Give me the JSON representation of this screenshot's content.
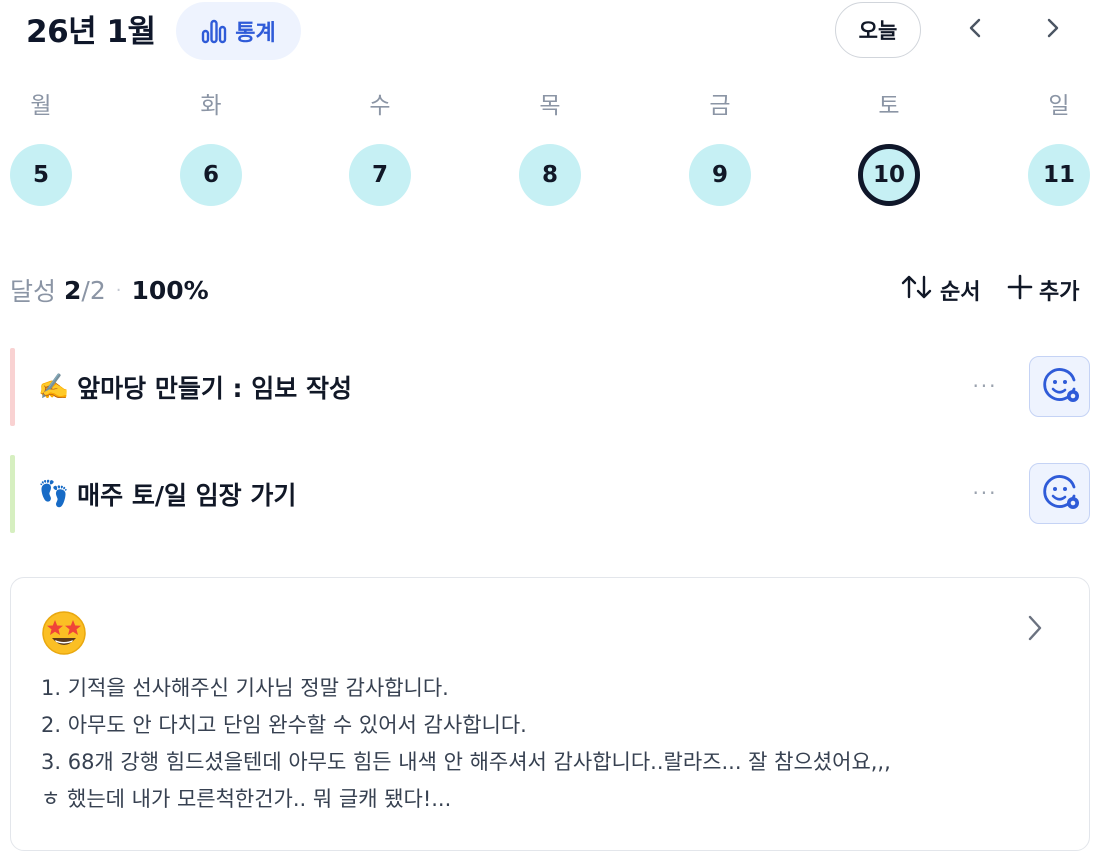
{
  "header": {
    "month_title": "26년 1월",
    "stats_label": "통계",
    "today_label": "오늘",
    "prev_icon": "chevron-left-icon",
    "next_icon": "chevron-right-icon"
  },
  "week": {
    "days": [
      {
        "label": "월",
        "date": "5",
        "selected": false
      },
      {
        "label": "화",
        "date": "6",
        "selected": false
      },
      {
        "label": "수",
        "date": "7",
        "selected": false
      },
      {
        "label": "목",
        "date": "8",
        "selected": false
      },
      {
        "label": "금",
        "date": "9",
        "selected": false
      },
      {
        "label": "토",
        "date": "10",
        "selected": true
      },
      {
        "label": "일",
        "date": "11",
        "selected": false
      }
    ],
    "circle_color": "#c6f0f4",
    "selected_ring_color": "#0f172a"
  },
  "summary": {
    "label": "달성",
    "done": "2",
    "slash": "/",
    "total": "2",
    "dot": "·",
    "percent": "100%"
  },
  "toolbar": {
    "order_label": "순서",
    "add_label": "추가"
  },
  "habits": [
    {
      "emoji": "✍️",
      "title": "앞마당 만들기 : 임보 작성",
      "bar_color": "#f9d2d2",
      "more": "···"
    },
    {
      "emoji": "👣",
      "title": "매주 토/일 임장 가기",
      "bar_color": "#d6efc0",
      "more": "···"
    }
  ],
  "journal": {
    "mood_icon": "star-struck-face-icon",
    "lines": [
      "1. 기적을 선사해주신 기사님 정말 감사합니다.",
      "2. 아무도 안 다치고 단임 완수할 수 있어서 감사합니다.",
      "3. 68개 강행 힘드셨을텐데 아무도 힘든 내색 안 해주셔서 감사합니다..랄라즈... 잘 참으셨어요,,,",
      "ㅎ 했는데 내가 모른척한건가.. 뭐 글캐 됐다!..."
    ]
  },
  "colors": {
    "accent": "#2f5bd8",
    "accent_bg": "#eef3fe",
    "muted_text": "#8b95a5"
  }
}
